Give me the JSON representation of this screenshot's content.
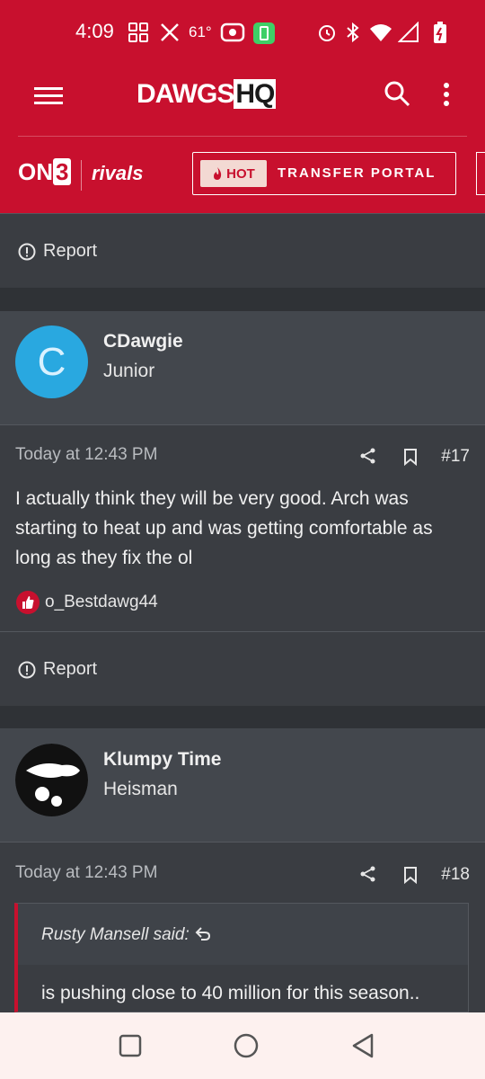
{
  "status_bar": {
    "time": "4:09",
    "temperature": "61°"
  },
  "site": {
    "logo_main": "DAWGS",
    "logo_hq": "HQ",
    "network_on": "ON",
    "network_3": "3",
    "network_rivals": "rivals"
  },
  "promo": {
    "hot": "HOT",
    "label": "TRANSFER PORTAL"
  },
  "colors": {
    "brand_red": "#c8102e",
    "avatar_blue": "#29a8e0"
  },
  "post_prev": {
    "report": "Report"
  },
  "post17": {
    "avatar_letter": "C",
    "username": "CDawgie",
    "rank": "Junior",
    "time": "Today at 12:43 PM",
    "number": "#17",
    "body": "I actually think they will be very good. Arch was starting to heat up and was getting comfortable as long as they fix the ol",
    "reactor": "o_Bestdawg44",
    "report": "Report"
  },
  "post18": {
    "username": "Klumpy Time",
    "rank": "Heisman",
    "time": "Today at 12:43 PM",
    "number": "#18",
    "quote_author": "Rusty Mansell said:",
    "quote_text": "is pushing close to 40 million for this season.."
  }
}
